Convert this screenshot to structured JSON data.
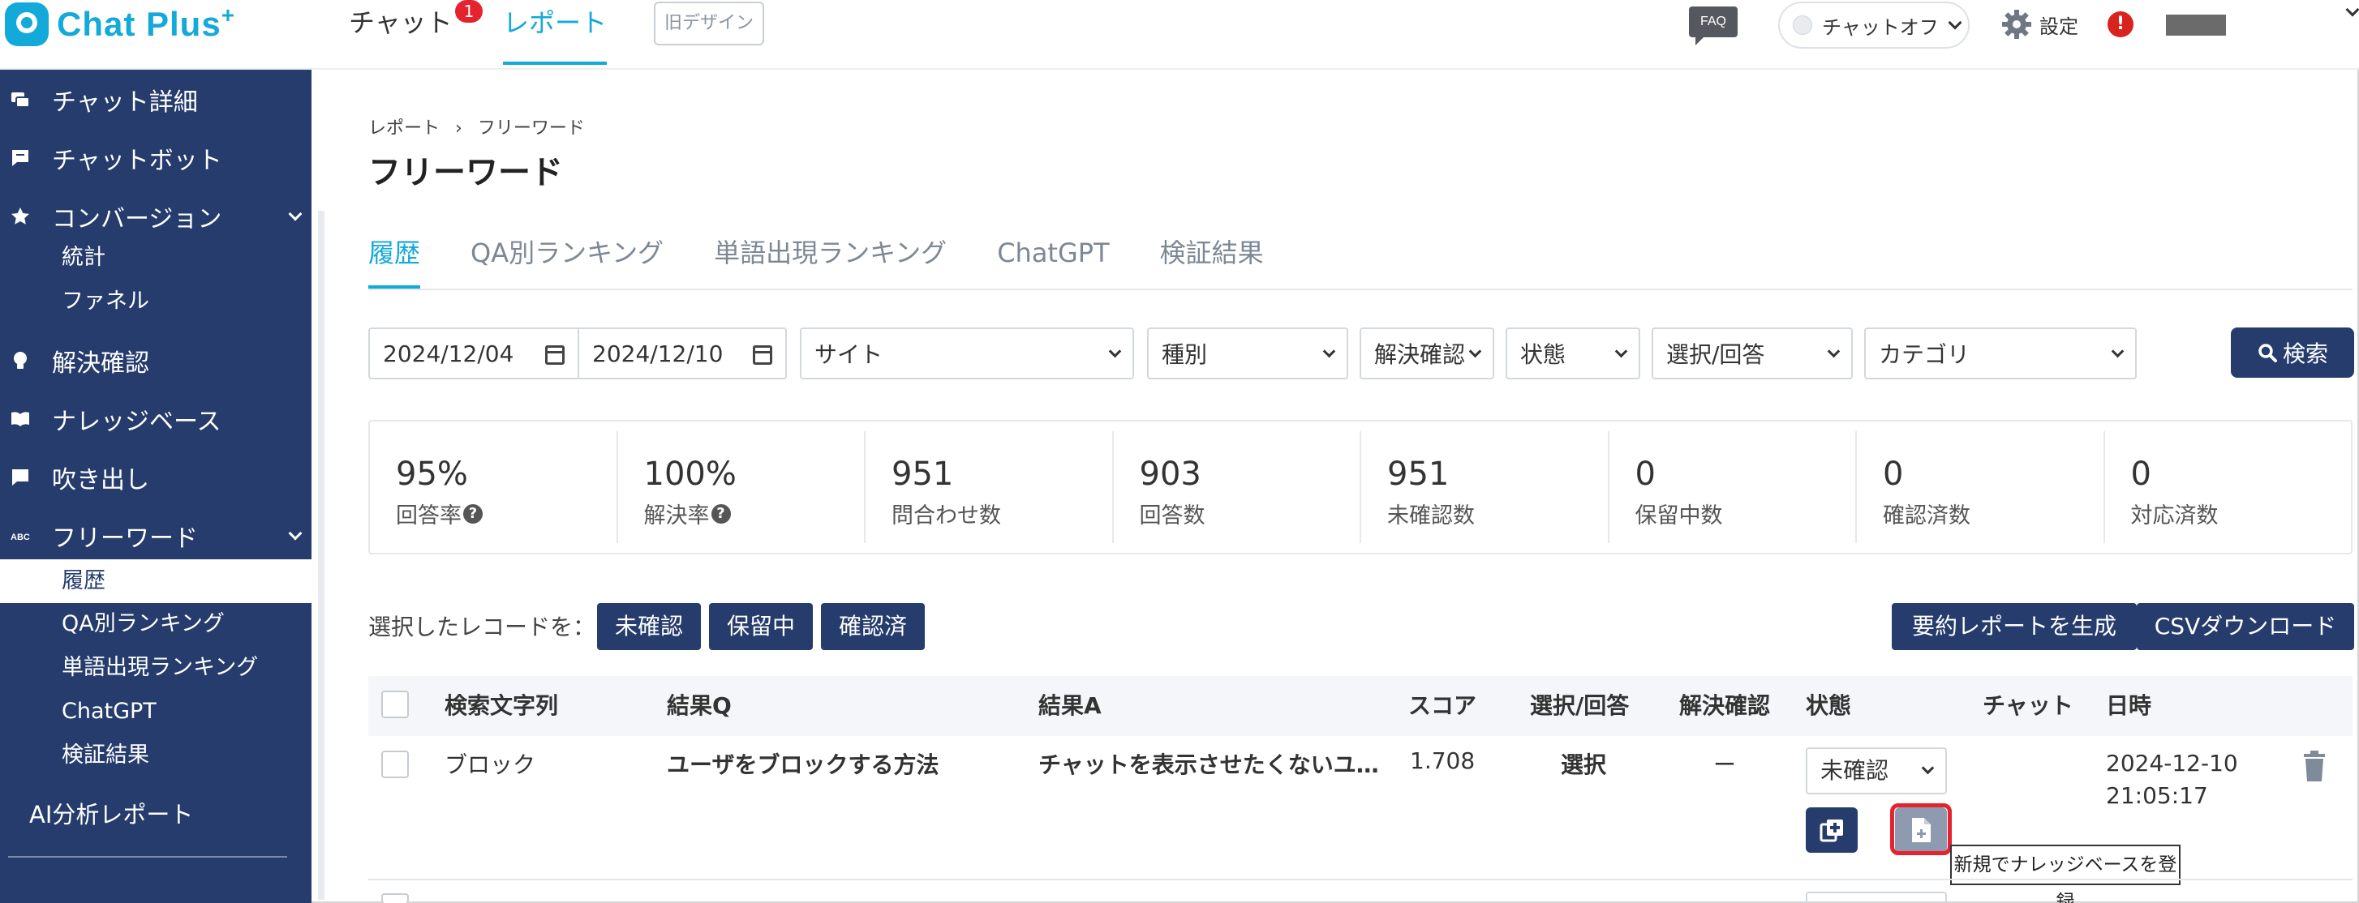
{
  "header": {
    "logo_text": "Chat Plus",
    "logo_sup": "+",
    "nav_chat": "チャット",
    "nav_chat_badge": "1",
    "nav_report": "レポート",
    "old_design": "旧デザイン",
    "faq": "FAQ",
    "chat_status": "チャットオフ",
    "settings": "設定",
    "alert": "!"
  },
  "sidebar": {
    "items": [
      {
        "label": "チャット詳細",
        "icon": "chat-bubbles-icon"
      },
      {
        "label": "チャットボット",
        "icon": "chatbot-bubble-icon"
      },
      {
        "label": "コンバージョン",
        "icon": "star-icon"
      },
      {
        "label": "解決確認",
        "icon": "lightbulb-icon"
      },
      {
        "label": "ナレッジベース",
        "icon": "book-icon"
      },
      {
        "label": "吹き出し",
        "icon": "speech-bubble-icon"
      },
      {
        "label": "フリーワード",
        "icon": "abc-icon"
      }
    ],
    "conversion_sub": [
      "統計",
      "ファネル"
    ],
    "freeword_sub": [
      "履歴",
      "QA別ランキング",
      "単語出現ランキング",
      "ChatGPT",
      "検証結果"
    ],
    "ai_report": "AI分析レポート"
  },
  "main": {
    "breadcrumb_root": "レポート",
    "breadcrumb_sep": "›",
    "breadcrumb_current": "フリーワード",
    "title": "フリーワード",
    "tabs": [
      "履歴",
      "QA別ランキング",
      "単語出現ランキング",
      "ChatGPT",
      "検証結果"
    ],
    "filters": {
      "date_from": "2024/12/04",
      "date_to": "2024/12/10",
      "site": "サイト",
      "kind": "種別",
      "resolution": "解決確認",
      "state": "状態",
      "choice": "選択/回答",
      "category": "カテゴリ",
      "search": "検索"
    },
    "stats": [
      {
        "value": "95%",
        "label": "回答率",
        "help": true
      },
      {
        "value": "100%",
        "label": "解決率",
        "help": true
      },
      {
        "value": "951",
        "label": "問合わせ数",
        "help": false
      },
      {
        "value": "903",
        "label": "回答数",
        "help": false
      },
      {
        "value": "951",
        "label": "未確認数",
        "help": false
      },
      {
        "value": "0",
        "label": "保留中数",
        "help": false
      },
      {
        "value": "0",
        "label": "確認済数",
        "help": false
      },
      {
        "value": "0",
        "label": "対応済数",
        "help": false
      }
    ],
    "help_glyph": "?",
    "selected_label": "選択したレコードを：",
    "btn_unconfirmed": "未確認",
    "btn_pending": "保留中",
    "btn_confirmed": "確認済",
    "btn_summary": "要約レポートを生成",
    "btn_csv": "CSVダウンロード",
    "table": {
      "headers": [
        "検索文字列",
        "結果Q",
        "結果A",
        "スコア",
        "選択/回答",
        "解決確認",
        "状態",
        "チャット",
        "日時"
      ],
      "rows": [
        {
          "query": "ブロック",
          "result_q": "ユーザをブロックする方法",
          "result_a": "チャットを表示させたくないユ…",
          "score": "1.708",
          "choice": "選択",
          "resolution": "ー",
          "state": "未確認",
          "date": "2024-12-10",
          "time": "21:05:17"
        }
      ]
    },
    "tooltip": "新規でナレッジベースを登録"
  },
  "colors": {
    "brand": "#13a9d9",
    "navy": "#253c6d",
    "badge_red": "#e5232e"
  }
}
